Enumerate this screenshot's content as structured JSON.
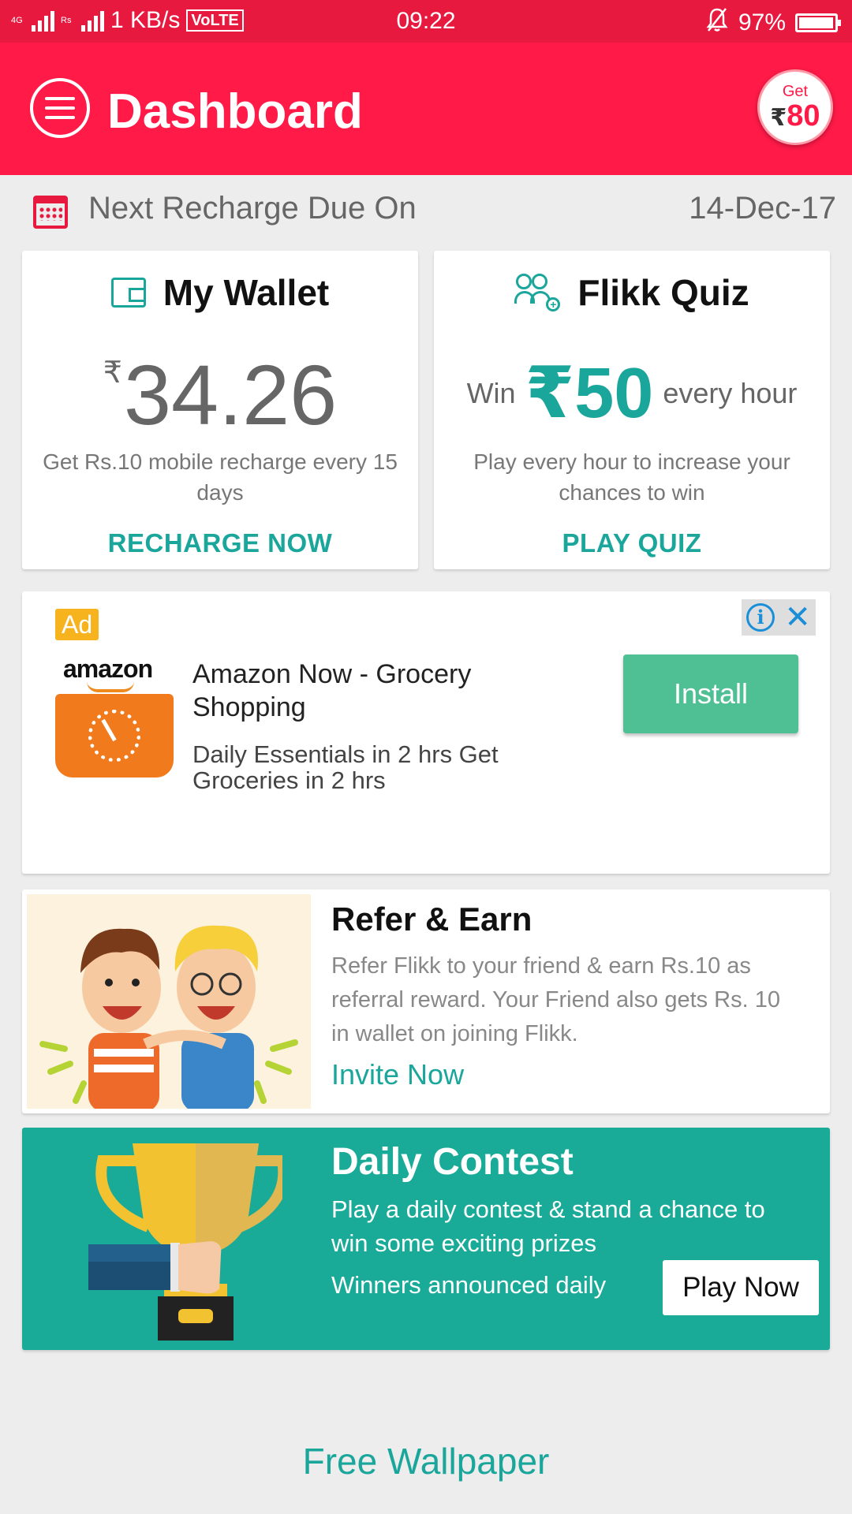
{
  "status_bar": {
    "network_tag_1": "4G",
    "network_tag_2": "Rs",
    "speed": "1 KB/s",
    "volte": "VoLTE",
    "time": "09:22",
    "battery": "97%",
    "battery_level": 0.97
  },
  "header": {
    "title": "Dashboard",
    "badge_top": "Get",
    "badge_currency": "₹",
    "badge_amount": "80"
  },
  "recharge_due": {
    "label": "Next Recharge Due On",
    "date": "14-Dec-17"
  },
  "wallet": {
    "title": "My Wallet",
    "currency": "₹",
    "amount": "34.26",
    "description": "Get Rs.10 mobile recharge every 15 days",
    "action": "RECHARGE NOW"
  },
  "quiz": {
    "title": "Flikk Quiz",
    "win_prefix": "Win",
    "win_amount": "₹50",
    "win_suffix": "every hour",
    "description": "Play every hour to increase your chances to win",
    "action": "PLAY QUIZ"
  },
  "ad": {
    "tag": "Ad",
    "brand": "amazon",
    "title": "Amazon Now - Grocery Shopping",
    "description": "Daily Essentials in 2 hrs Get Groceries in 2 hrs",
    "button": "Install",
    "info_symbol": "i",
    "close_symbol": "✕"
  },
  "refer": {
    "title": "Refer & Earn",
    "description": "Refer Flikk to your friend & earn Rs.10 as referral reward. Your Friend also gets Rs. 10 in wallet on joining Flikk.",
    "link": "Invite Now"
  },
  "contest": {
    "title": "Daily Contest",
    "description": "Play a daily contest & stand a chance to win some exciting prizes",
    "note": "Winners announced daily",
    "button": "Play Now"
  },
  "footer_link": "Free Wallpaper",
  "colors": {
    "brand_red": "#ff1a48",
    "teal": "#1aa69b",
    "install_green": "#4fbf94",
    "ad_tag": "#f6b31e"
  }
}
